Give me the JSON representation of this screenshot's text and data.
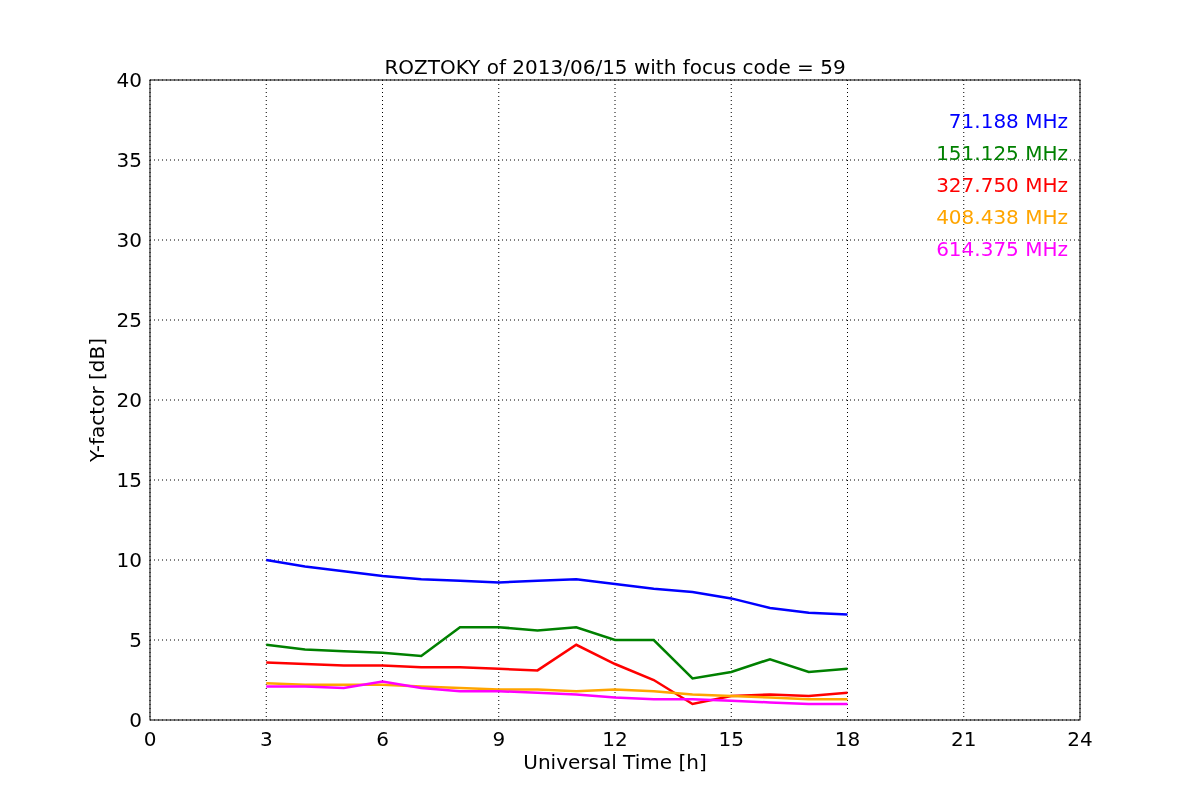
{
  "chart_data": {
    "type": "line",
    "title": "ROZTOKY of 2013/06/15 with focus code = 59",
    "xlabel": "Universal Time [h]",
    "ylabel": "Y-factor [dB]",
    "x": [
      3,
      4,
      5,
      6,
      7,
      8,
      9,
      10,
      11,
      12,
      13,
      14,
      15,
      16,
      17,
      18
    ],
    "series": [
      {
        "name": "71.188 MHz",
        "color": "#0000ff",
        "values": [
          10,
          9.6,
          9.3,
          9,
          8.8,
          8.7,
          8.6,
          8.7,
          8.8,
          8.5,
          8.2,
          8,
          7.6,
          7,
          6.7,
          6.6
        ]
      },
      {
        "name": "151.125 MHz",
        "color": "#008000",
        "values": [
          4.7,
          4.4,
          4.3,
          4.2,
          4,
          5.8,
          5.8,
          5.6,
          5.8,
          5,
          5,
          2.6,
          3,
          3.8,
          3,
          3.2
        ]
      },
      {
        "name": "327.750 MHz",
        "color": "#ff0000",
        "values": [
          3.6,
          3.5,
          3.4,
          3.4,
          3.3,
          3.3,
          3.2,
          3.1,
          4.7,
          3.5,
          2.5,
          1,
          1.5,
          1.6,
          1.5,
          1.7
        ]
      },
      {
        "name": "408.438 MHz",
        "color": "#ffa500",
        "values": [
          2.3,
          2.2,
          2.2,
          2.2,
          2.1,
          2,
          1.9,
          1.9,
          1.8,
          1.9,
          1.8,
          1.6,
          1.5,
          1.4,
          1.3,
          1.3
        ]
      },
      {
        "name": "614.375 MHz",
        "color": "#ff00ff",
        "values": [
          2.1,
          2.1,
          2,
          2.4,
          2,
          1.8,
          1.8,
          1.7,
          1.6,
          1.4,
          1.3,
          1.3,
          1.2,
          1.1,
          1,
          1
        ]
      }
    ],
    "grid": true,
    "xlim": [
      0,
      24
    ],
    "ylim": [
      0,
      40
    ],
    "xticks": [
      0,
      3,
      6,
      9,
      12,
      15,
      18,
      21,
      24
    ],
    "yticks": [
      0,
      5,
      10,
      15,
      20,
      25,
      30,
      35,
      40
    ]
  }
}
